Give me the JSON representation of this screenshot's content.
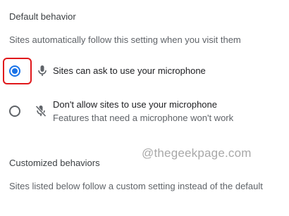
{
  "default_behavior": {
    "heading": "Default behavior",
    "description": "Sites automatically follow this setting when you visit them",
    "options": [
      {
        "label": "Sites can ask to use your microphone",
        "selected": true,
        "icon": "microphone-icon"
      },
      {
        "label": "Don't allow sites to use your microphone",
        "sublabel": "Features that need a microphone won't work",
        "selected": false,
        "icon": "microphone-off-icon"
      }
    ]
  },
  "customized_behaviors": {
    "heading": "Customized behaviors",
    "description": "Sites listed below follow a custom setting instead of the default"
  },
  "watermark": "@thegeekpage.com",
  "colors": {
    "accent": "#1a73e8",
    "highlight": "#e0181b",
    "muted_text": "#5f6368"
  }
}
